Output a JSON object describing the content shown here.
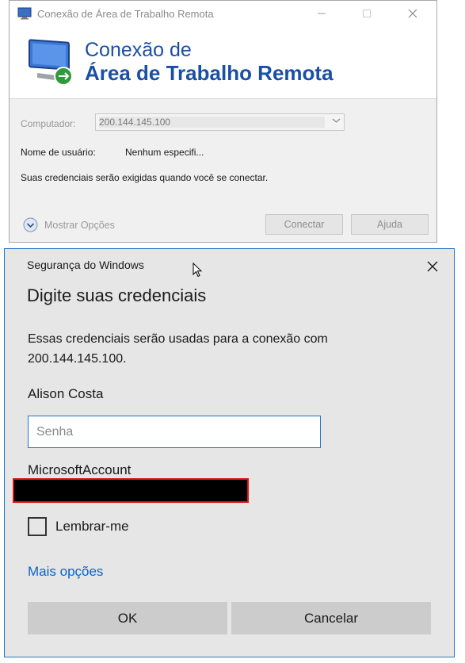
{
  "rdp_window": {
    "title": "Conexão de Área de Trabalho Remota",
    "banner_line1": "Conexão de",
    "banner_line2": "Área de Trabalho Remota",
    "computer_label": "Computador:",
    "computer_value": "200.144.145.100",
    "username_label": "Nome de usuário:",
    "username_value": "Nenhum especifi...",
    "credentials_note": "Suas credenciais serão exigidas quando você se conectar.",
    "show_options_label": "Mostrar Opções",
    "connect_label": "Conectar",
    "help_label": "Ajuda"
  },
  "credential_dialog": {
    "title": "Segurança do Windows",
    "heading": "Digite suas credenciais",
    "message": "Essas credenciais serão usadas para a conexão com 200.144.145.100.",
    "user_name": "Alison Costa",
    "password_placeholder": "Senha",
    "password_value": "",
    "account_label": "MicrosoftAccount",
    "remember_label": "Lembrar-me",
    "remember_checked": false,
    "more_options_label": "Mais opções",
    "ok_label": "OK",
    "cancel_label": "Cancelar"
  },
  "colors": {
    "accent_blue": "#1f75c9",
    "link_blue": "#0a63c9",
    "banner_blue": "#1a4fa6",
    "dialog_bg": "#e6e6e6",
    "redaction_border": "#dd1111"
  },
  "icons": [
    "rdp-monitor-icon",
    "minimize-icon",
    "maximize-icon",
    "close-icon",
    "expand-chevron-icon",
    "checkbox-icon",
    "mouse-cursor-icon"
  ]
}
